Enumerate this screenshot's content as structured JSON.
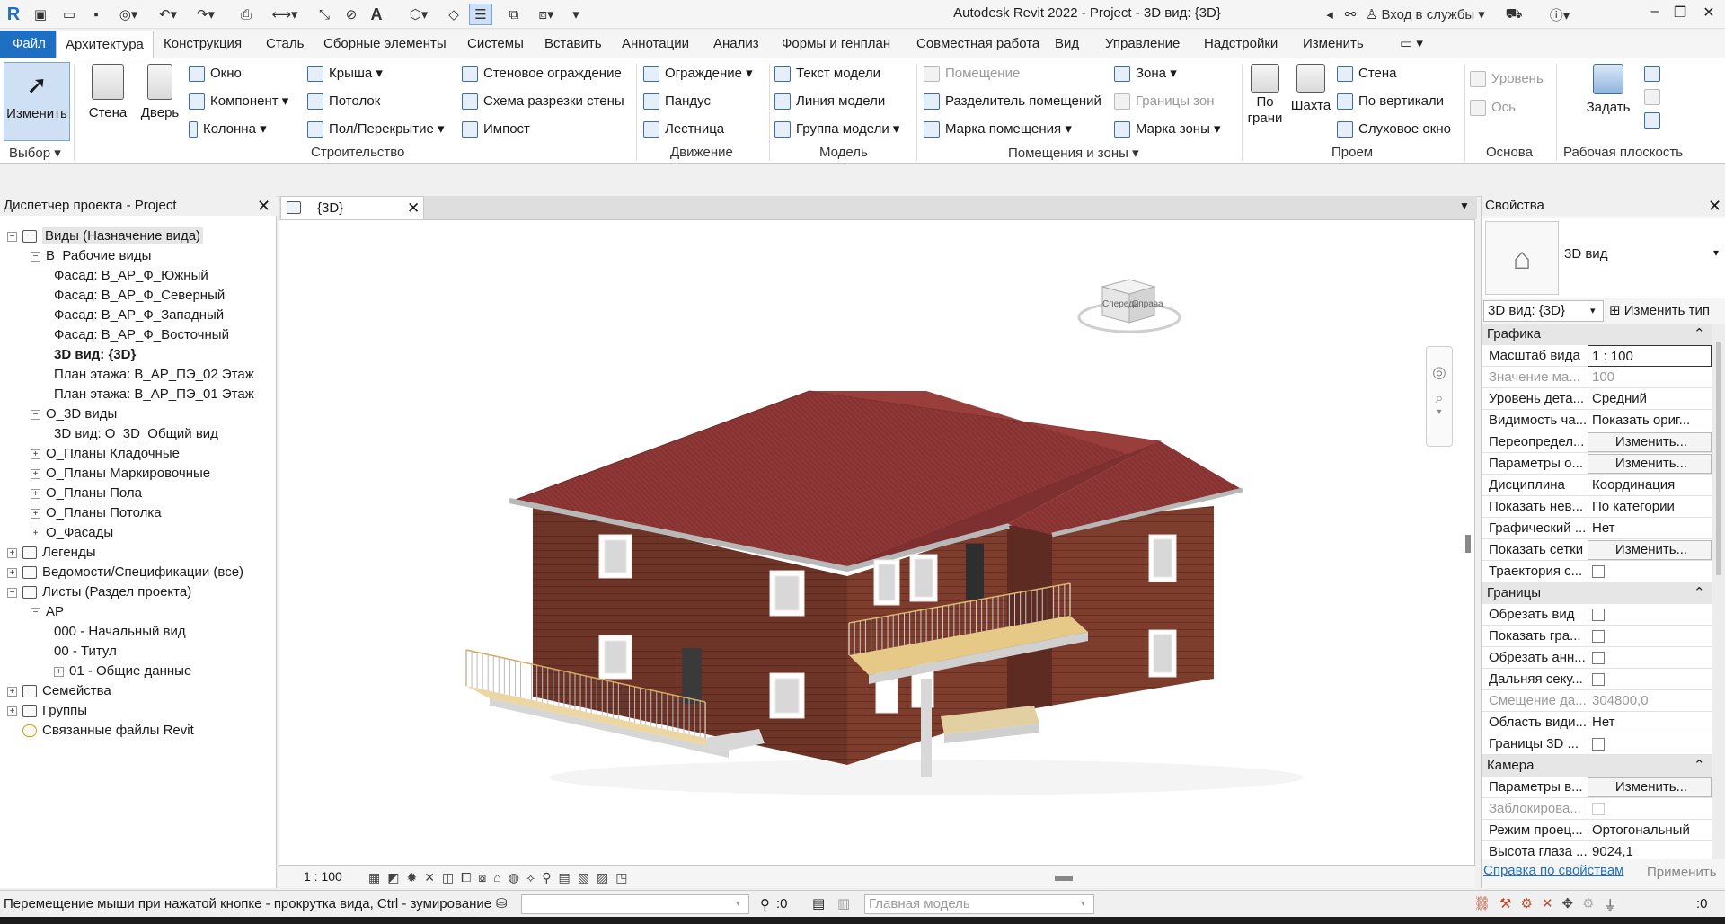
{
  "app": {
    "title": "Autodesk Revit 2022 - Project - 3D вид: {3D}",
    "sign_in": "Вход в службы",
    "accent": "#1e6fc2"
  },
  "menu": {
    "file": "Файл",
    "tabs": [
      "Архитектура",
      "Конструкция",
      "Сталь",
      "Сборные элементы",
      "Системы",
      "Вставить",
      "Аннотации",
      "Анализ",
      "Формы и генплан",
      "Совместная работа",
      "Вид",
      "Управление",
      "Надстройки",
      "Изменить"
    ]
  },
  "ribbon": {
    "modify": "Изменить",
    "select": "Выбор",
    "wall": "Стена",
    "door": "Дверь",
    "window": "Окно",
    "component": "Компонент",
    "column": "Колонна",
    "roof": "Крыша",
    "ceiling": "Потолок",
    "floor": "Пол/Перекрытие",
    "curtain_system": "Стеновое ограждение",
    "curtain_grid": "Схема разрезки стены",
    "mullion": "Импост",
    "build_label": "Строительство",
    "railing": "Ограждение",
    "ramp": "Пандус",
    "stair": "Лестница",
    "circulation_label": "Движение",
    "model_text": "Текст модели",
    "model_line": "Линия модели",
    "model_group": "Группа модели",
    "model_label": "Модель",
    "room": "Помещение",
    "room_separator": "Разделитель помещений",
    "room_tag": "Марка помещения",
    "area": "Зона",
    "area_boundary": "Границы зон",
    "area_tag": "Марка зоны",
    "room_area_label": "Помещения и зоны",
    "by_face": "По\nграни",
    "by_face_1": "По",
    "by_face_2": "грани",
    "shaft": "Шахта",
    "opening_wall": "Стена",
    "vertical": "По вертикали",
    "dormer": "Слуховое окно",
    "opening_label": "Проем",
    "level": "Уровень",
    "grid": "Ось",
    "datum_label": "Основа",
    "set": "Задать",
    "workplane_label": "Рабочая плоскость"
  },
  "browser": {
    "title": "Диспетчер проекта - Project",
    "items": [
      {
        "label": "Виды (Назначение вида)",
        "toggle": "−"
      },
      {
        "label": "В_Рабочие виды",
        "toggle": "−"
      },
      {
        "label": "Фасад: В_АР_Ф_Южный"
      },
      {
        "label": "Фасад: В_АР_Ф_Северный"
      },
      {
        "label": "Фасад: В_АР_Ф_Западный"
      },
      {
        "label": "Фасад: В_АР_Ф_Восточный"
      },
      {
        "label": "3D вид: {3D}"
      },
      {
        "label": "План этажа: В_АР_ПЭ_02 Этаж"
      },
      {
        "label": "План этажа: В_АР_ПЭ_01 Этаж"
      },
      {
        "label": "О_3D виды",
        "toggle": "−"
      },
      {
        "label": "3D вид: О_3D_Общий вид"
      },
      {
        "label": "О_Планы Кладочные",
        "toggle": "+"
      },
      {
        "label": "О_Планы Маркировочные",
        "toggle": "+"
      },
      {
        "label": "О_Планы Пола",
        "toggle": "+"
      },
      {
        "label": "О_Планы Потолка",
        "toggle": "+"
      },
      {
        "label": "О_Фасады",
        "toggle": "+"
      },
      {
        "label": "Легенды",
        "toggle": "+"
      },
      {
        "label": "Ведомости/Спецификации (все)",
        "toggle": "+"
      },
      {
        "label": "Листы (Раздел проекта)",
        "toggle": "−"
      },
      {
        "label": "АР",
        "toggle": "−"
      },
      {
        "label": "000 - Начальный вид"
      },
      {
        "label": "00 - Титул"
      },
      {
        "label": "01 - Общие данные",
        "toggle": "+"
      },
      {
        "label": "Семейства",
        "toggle": "+"
      },
      {
        "label": "Группы",
        "toggle": "+"
      },
      {
        "label": "Связанные файлы Revit"
      }
    ]
  },
  "view": {
    "tab_label": "{3D}",
    "scale": "1 : 100",
    "viewcube_front": "Спереди",
    "viewcube_right": "Справа"
  },
  "properties": {
    "title": "Свойства",
    "type_name": "3D вид",
    "selector": "3D вид: {3D}",
    "edit_type": "Изменить тип",
    "groups": {
      "graphics": "Графика",
      "extents": "Границы",
      "camera": "Камера"
    },
    "graphics_rows": [
      {
        "name": "Масштаб вида",
        "value": "1 : 100"
      },
      {
        "name": "Значение ма...",
        "value": "100",
        "disabled": true
      },
      {
        "name": "Уровень дета...",
        "value": "Средний"
      },
      {
        "name": "Видимость ча...",
        "value": "Показать ориг..."
      },
      {
        "name": "Переопредел...",
        "value": "Изменить...",
        "button": true
      },
      {
        "name": "Параметры о...",
        "value": "Изменить...",
        "button": true
      },
      {
        "name": "Дисциплина",
        "value": "Координация"
      },
      {
        "name": "Показать нев...",
        "value": "По категории"
      },
      {
        "name": "Графический ...",
        "value": "Нет"
      },
      {
        "name": "Показать сетки",
        "value": "Изменить...",
        "button": true
      },
      {
        "name": "Траектория с...",
        "value": "",
        "checkbox": true
      }
    ],
    "extents_rows": [
      {
        "name": "Обрезать вид",
        "value": "",
        "checkbox": true
      },
      {
        "name": "Показать гра...",
        "value": "",
        "checkbox": true
      },
      {
        "name": "Обрезать анн...",
        "value": "",
        "checkbox": true
      },
      {
        "name": "Дальняя секу...",
        "value": "",
        "checkbox": true
      },
      {
        "name": "Смещение да...",
        "value": "304800,0",
        "disabled": true
      },
      {
        "name": "Область види...",
        "value": "Нет"
      },
      {
        "name": "Границы 3D ...",
        "value": "",
        "checkbox": true
      }
    ],
    "camera_rows": [
      {
        "name": "Параметры в...",
        "value": "Изменить...",
        "button": true
      },
      {
        "name": "Заблокирова...",
        "value": "",
        "checkbox": true,
        "disabled": true
      },
      {
        "name": "Режим проец...",
        "value": "Ортогональный"
      },
      {
        "name": "Высота глаза ...",
        "value": "9024,1"
      }
    ],
    "help_link": "Справка по свойствам",
    "apply": "Применить"
  },
  "status": {
    "message": "Перемещение мыши при нажатой кнопке - прокрутка вида, Ctrl - зумирование",
    "zero1": ":0",
    "main_model": "Главная модель",
    "filter_count": ":0"
  },
  "colors": {
    "roof": "#8a3432",
    "brick": "#6b3228",
    "railing": "#e8c27a"
  }
}
